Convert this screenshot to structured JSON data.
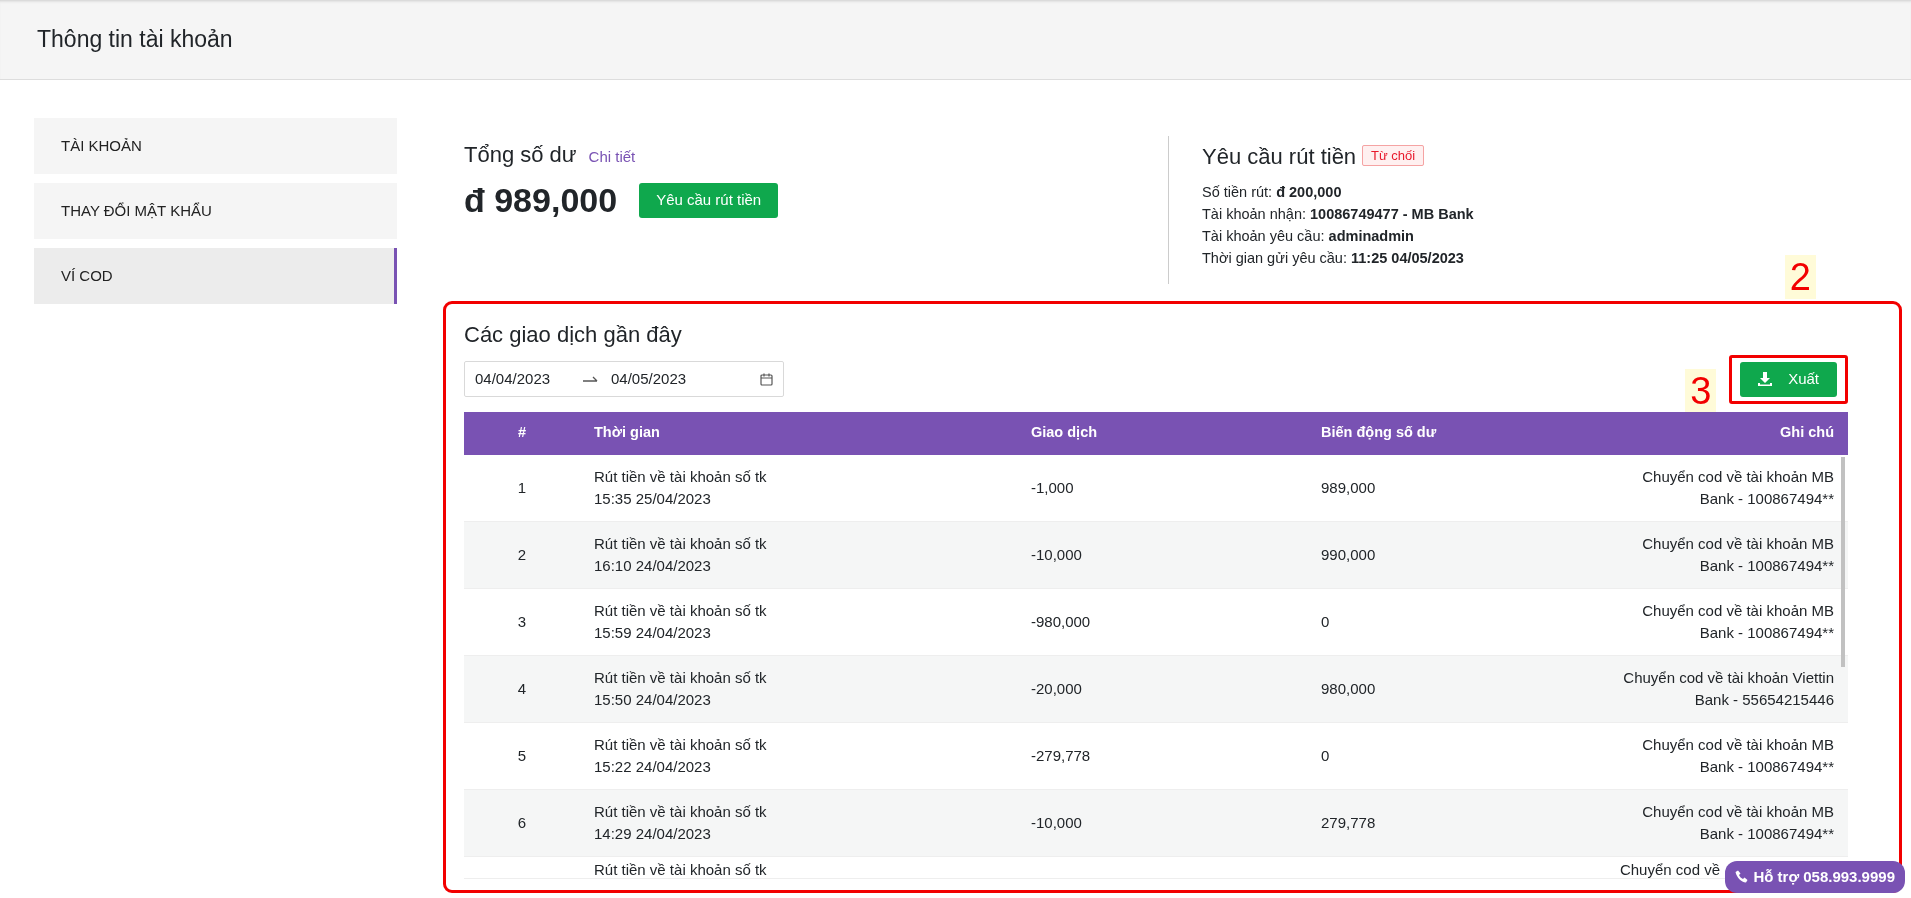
{
  "header": {
    "title": "Thông tin tài khoản"
  },
  "sidebar": {
    "items": [
      {
        "label": "TÀI KHOẢN",
        "selected": false
      },
      {
        "label": "THAY ĐỔI MẬT KHẨU",
        "selected": false
      },
      {
        "label": "VÍ COD",
        "selected": true
      }
    ]
  },
  "balance": {
    "title": "Tổng số dư",
    "detail_link": "Chi tiết",
    "amount": "đ 989,000",
    "button": "Yêu cầu rút tiền"
  },
  "withdrawal": {
    "title": "Yêu cầu rút tiền",
    "status": "Từ chối",
    "lines": [
      "Số tiền rút: **đ 200,000**",
      "Tài khoản nhận: **10086749477 - MB Bank**",
      "Tài khoản yêu cầu: **adminadmin**",
      "Thời gian gửi yêu cầu: **11:25 04/05/2023**"
    ]
  },
  "transactions": {
    "title": "Các giao dịch gần đây",
    "date_from": "04/04/2023",
    "date_to": "04/05/2023",
    "export_button": "Xuất",
    "table": {
      "columns": [
        "#",
        "Thời gian",
        "Giao dịch",
        "Biến động số dư",
        "Ghi chú"
      ],
      "rows": [
        {
          "index": "1",
          "description": "Rút tiền về tài khoản số tk",
          "time": "15:35 25/04/2023",
          "amount": "-1,000",
          "balance": "989,000",
          "note_lines": [
            "Chuyển cod về tài khoản MB",
            "Bank - 100867494**"
          ]
        },
        {
          "index": "2",
          "description": "Rút tiền về tài khoản số tk",
          "time": "16:10 24/04/2023",
          "amount": "-10,000",
          "balance": "990,000",
          "note_lines": [
            "Chuyển cod về tài khoản MB",
            "Bank - 100867494**"
          ]
        },
        {
          "index": "3",
          "description": "Rút tiền về tài khoản số tk",
          "time": "15:59 24/04/2023",
          "amount": "-980,000",
          "balance": "0",
          "note_lines": [
            "Chuyển cod về tài khoản MB",
            "Bank - 100867494**"
          ]
        },
        {
          "index": "4",
          "description": "Rút tiền về tài khoản số tk",
          "time": "15:50 24/04/2023",
          "amount": "-20,000",
          "balance": "980,000",
          "note_lines": [
            "Chuyển cod về tài khoản Viettin",
            "Bank - 55654215446"
          ]
        },
        {
          "index": "5",
          "description": "Rút tiền về tài khoản số tk",
          "time": "15:22 24/04/2023",
          "amount": "-279,778",
          "balance": "0",
          "note_lines": [
            "Chuyển cod về tài khoản MB",
            "Bank - 100867494**"
          ]
        },
        {
          "index": "6",
          "description": "Rút tiền về tài khoản số tk",
          "time": "14:29 24/04/2023",
          "amount": "-10,000",
          "balance": "279,778",
          "note_lines": [
            "Chuyển cod về tài khoản MB",
            "Bank - 100867494**"
          ]
        },
        {
          "description": "Rút tiền về tài khoản số tk",
          "note_lines": [
            "Chuyển cod về"
          ]
        }
      ]
    }
  },
  "annotations": [
    {
      "label": "2"
    },
    {
      "label": "3"
    }
  ],
  "support_button": "Hỗ trợ 058.993.9999"
}
